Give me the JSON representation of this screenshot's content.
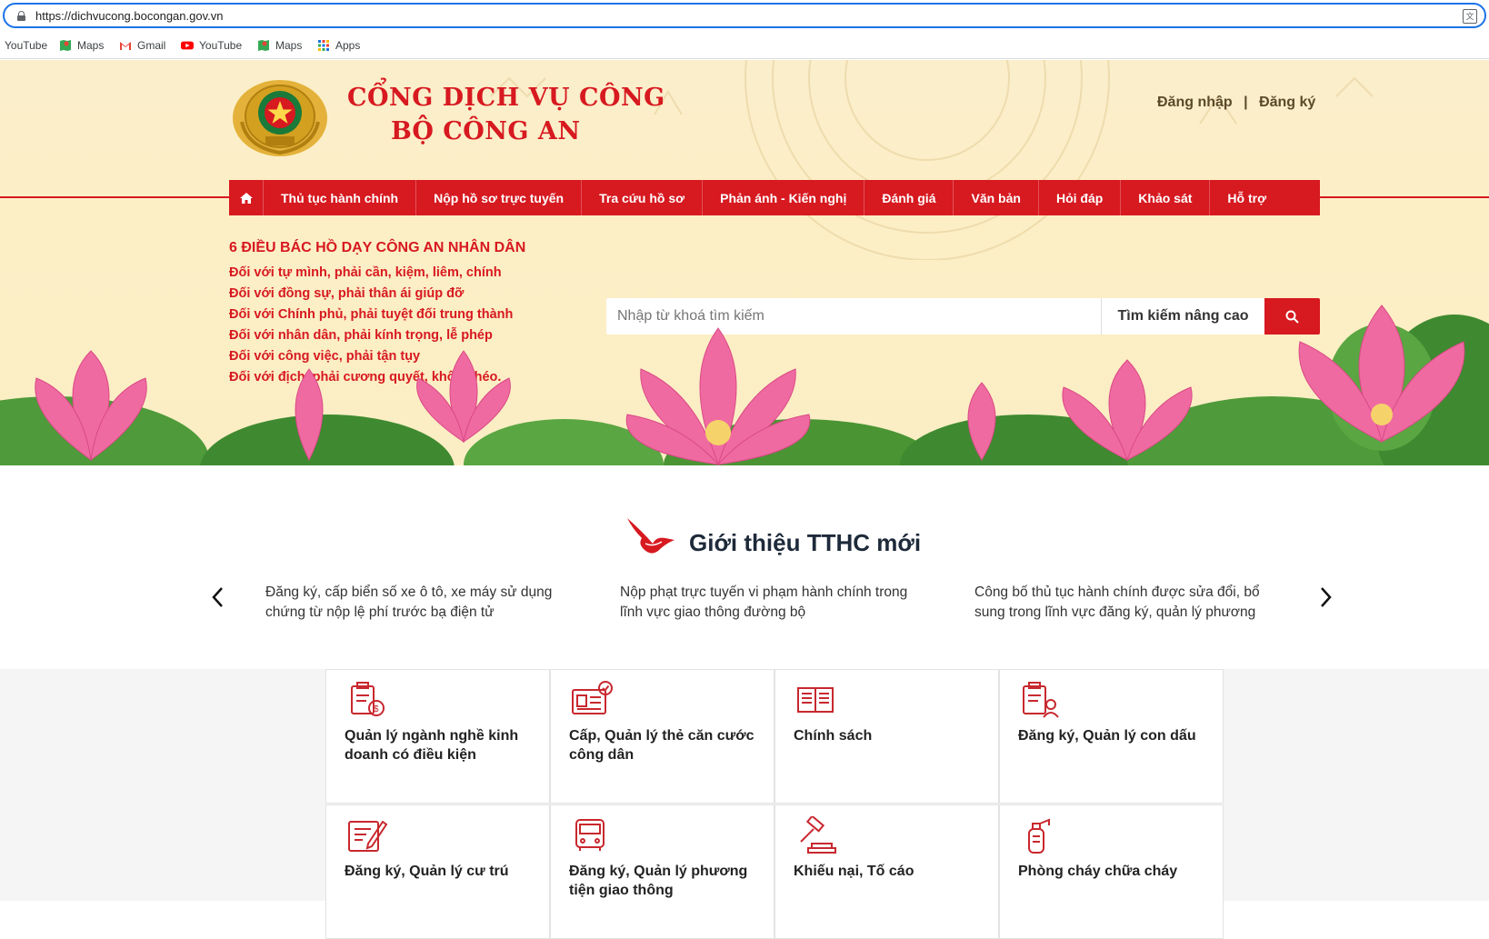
{
  "browser": {
    "url": "https://dichvucong.bocongan.gov.vn",
    "bookmarks": [
      {
        "label": "YouTube",
        "icon": "none"
      },
      {
        "label": "Maps",
        "icon": "maps-icon"
      },
      {
        "label": "Gmail",
        "icon": "gmail-icon"
      },
      {
        "label": "YouTube",
        "icon": "youtube-icon"
      },
      {
        "label": "Maps",
        "icon": "maps-icon"
      },
      {
        "label": "Apps",
        "icon": "apps-grid-icon"
      }
    ]
  },
  "header": {
    "title_line1": "CỔNG DỊCH VỤ CÔNG",
    "title_line2": "BỘ CÔNG AN",
    "login": "Đăng nhập",
    "separator": "|",
    "register": "Đăng ký"
  },
  "nav": {
    "home_icon": "home-icon",
    "items": [
      "Thủ tục hành chính",
      "Nộp hồ sơ trực tuyến",
      "Tra cứu hồ sơ",
      "Phản ánh - Kiến nghị",
      "Đánh giá",
      "Văn bản",
      "Hỏi đáp",
      "Khảo sát",
      "Hỗ trợ"
    ]
  },
  "teachings": {
    "title": "6 ĐIỀU BÁC HỒ DẠY CÔNG AN NHÂN DÂN",
    "lines": [
      "Đối với tự mình, phải cần, kiệm, liêm, chính",
      "Đối với đồng sự, phải thân ái giúp đỡ",
      "Đối với Chính phủ, phải tuyệt đối trung thành",
      "Đối với nhân dân, phải kính trọng, lễ phép",
      "Đối với công việc, phải tận tụy",
      "Đối với địch, phải cương quyết, khôn khéo."
    ]
  },
  "search": {
    "placeholder": "Nhập từ khoá tìm kiếm",
    "advanced": "Tìm kiếm nâng cao",
    "button_icon": "search-icon"
  },
  "intro": {
    "heading": "Giới thiệu TTHC mới",
    "items": [
      "Đăng ký, cấp biển số xe ô tô, xe máy sử dụng chứng từ nộp lệ phí trước bạ điện tử",
      "Nộp phạt trực tuyến vi phạm hành chính trong lĩnh vực giao thông đường bộ",
      "Công bố thủ tục hành chính được sửa đổi, bổ sung trong lĩnh vực đăng ký, quản lý phương"
    ]
  },
  "cards": [
    {
      "label": "Quản lý ngành nghề kinh doanh có điều kiện",
      "icon": "business-license-icon"
    },
    {
      "label": "Cấp, Quản lý thẻ căn cước công dân",
      "icon": "id-card-icon"
    },
    {
      "label": "Chính sách",
      "icon": "book-icon"
    },
    {
      "label": "Đăng ký, Quản lý con dấu",
      "icon": "seal-register-icon"
    },
    {
      "label": "Đăng ký, Quản lý cư trú",
      "icon": "residence-form-icon"
    },
    {
      "label": "Đăng ký, Quản lý phương tiện giao thông",
      "icon": "vehicle-icon"
    },
    {
      "label": "Khiếu nại, Tố cáo",
      "icon": "gavel-icon"
    },
    {
      "label": "Phòng cháy chữa cháy",
      "icon": "fire-extinguisher-icon"
    }
  ],
  "colors": {
    "brand_red": "#d71920",
    "banner_bg": "#fbeecb"
  }
}
